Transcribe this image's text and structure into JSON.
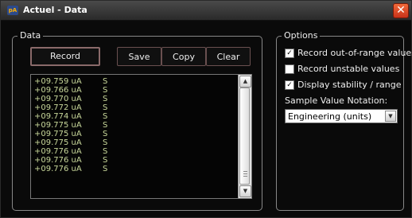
{
  "window": {
    "title": "Actuel - Data",
    "icon_text": "pA",
    "close_symbol": "✕"
  },
  "data_group": {
    "label": "Data",
    "buttons": {
      "record": "Record",
      "save": "Save",
      "copy": "Copy",
      "clear": "Clear"
    },
    "readings": [
      {
        "value": "+09.759 uA",
        "flag": "S"
      },
      {
        "value": "+09.766 uA",
        "flag": "S"
      },
      {
        "value": "+09.770 uA",
        "flag": "S"
      },
      {
        "value": "+09.772 uA",
        "flag": "S"
      },
      {
        "value": "+09.774 uA",
        "flag": "S"
      },
      {
        "value": "+09.775 uA",
        "flag": "S"
      },
      {
        "value": "+09.775 uA",
        "flag": "S"
      },
      {
        "value": "+09.775 uA",
        "flag": "S"
      },
      {
        "value": "+09.776 uA",
        "flag": "S"
      },
      {
        "value": "+09.776 uA",
        "flag": "S"
      },
      {
        "value": "+09.776 uA",
        "flag": "S"
      }
    ]
  },
  "options_group": {
    "label": "Options",
    "checkboxes": [
      {
        "label": "Record out-of-range values",
        "checked": true
      },
      {
        "label": "Record unstable values",
        "checked": false
      },
      {
        "label": "Display stability / range",
        "checked": true
      }
    ],
    "notation_label": "Sample Value Notation:",
    "notation_selected": "Engineering (units)"
  },
  "colors": {
    "reading_text": "#c8d79a",
    "close_button": "#e0482a",
    "background": "#0a0a0a"
  }
}
